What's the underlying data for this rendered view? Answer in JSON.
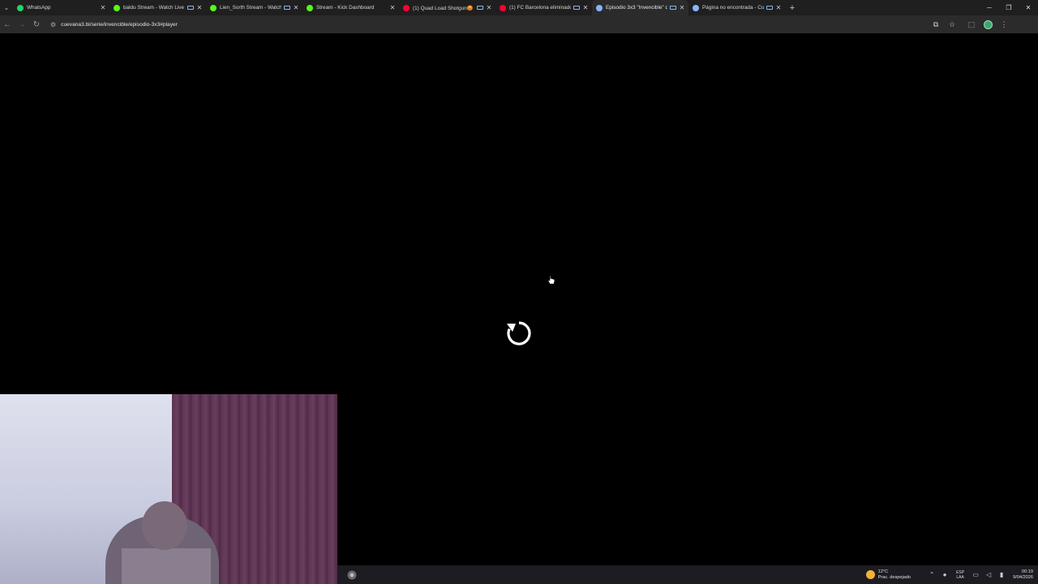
{
  "browser": {
    "tabs": [
      {
        "title": "WhatsApp",
        "favicon": "whatsapp-icon",
        "color": "#25d366",
        "cast": false,
        "active": false
      },
      {
        "title": "baldu Stream - Watch Live",
        "favicon": "kick-icon",
        "color": "#53fc18",
        "cast": true,
        "active": false
      },
      {
        "title": "Lien_Sorth Stream - Watch Live",
        "favicon": "kick-icon",
        "color": "#53fc18",
        "cast": true,
        "active": false
      },
      {
        "title": "Stream - Kick Dashboard",
        "favicon": "kick-icon",
        "color": "#53fc18",
        "cast": false,
        "active": false
      },
      {
        "title": "(1) Quad Load Shotgun😡 (",
        "favicon": "youtube-icon",
        "color": "#ff0033",
        "cast": true,
        "active": false
      },
      {
        "title": "(1) FC Barcelona eliminado",
        "favicon": "youtube-icon",
        "color": "#ff0033",
        "cast": true,
        "active": false
      },
      {
        "title": "Episodio 3x3 \"Invencible\" d",
        "favicon": "cuevana-icon",
        "color": "#8ab4f8",
        "cast": true,
        "active": true
      },
      {
        "title": "Página no encontrada - Cu",
        "favicon": "cuevana-icon",
        "color": "#8ab4f8",
        "cast": true,
        "active": false
      }
    ],
    "new_tab_label": "+",
    "url": "cuevana3.bi/serie/invencible/episodio-3x3#player"
  },
  "taskbar": {
    "weather_temp": "12°C",
    "weather_desc": "Prac. despejado",
    "lang_top": "ESP",
    "lang_bottom": "LAA",
    "time": "00:19",
    "date": "9/04/2026"
  }
}
